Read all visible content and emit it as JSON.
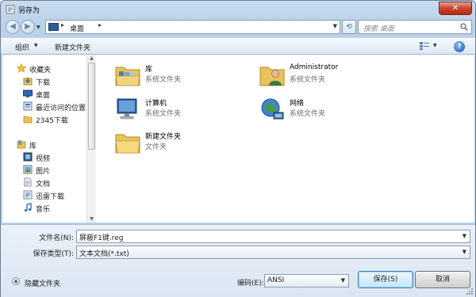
{
  "window": {
    "title": "另存为",
    "close_label": "✕"
  },
  "address": {
    "crumb": "桌面",
    "search_placeholder": "搜索 桌面"
  },
  "toolbar": {
    "organize_label": "组织",
    "new_folder_label": "新建文件夹"
  },
  "nav": {
    "favorites": [
      {
        "label": "收藏夹",
        "icon": "star-icon"
      },
      {
        "label": "下载",
        "icon": "download-folder-icon"
      },
      {
        "label": "桌面",
        "icon": "desktop-icon"
      },
      {
        "label": "最近访问的位置",
        "icon": "recent-places-icon"
      },
      {
        "label": "2345下载",
        "icon": "folder-icon"
      }
    ],
    "libraries": [
      {
        "label": "库",
        "icon": "library-icon"
      },
      {
        "label": "视频",
        "icon": "video-icon"
      },
      {
        "label": "图片",
        "icon": "picture-icon"
      },
      {
        "label": "文档",
        "icon": "document-icon"
      },
      {
        "label": "迅雷下载",
        "icon": "thunder-download-icon"
      },
      {
        "label": "音乐",
        "icon": "music-icon"
      }
    ]
  },
  "content": {
    "items": [
      {
        "name": "库",
        "type": "系统文件夹",
        "icon": "library-folder-icon"
      },
      {
        "name": "Administrator",
        "type": "系统文件夹",
        "icon": "user-folder-icon"
      },
      {
        "name": "计算机",
        "type": "系统文件夹",
        "icon": "computer-icon"
      },
      {
        "name": "网络",
        "type": "系统文件夹",
        "icon": "network-icon"
      },
      {
        "name": "新建文件夹",
        "type": "文件夹",
        "icon": "folder-icon"
      }
    ]
  },
  "form": {
    "filename_label": "文件名(N):",
    "filename_value": "屏蔽F1键.reg",
    "savetype_label": "保存类型(T):",
    "savetype_value": "文本文档(*.txt)",
    "hide_folders_label": "隐藏文件夹",
    "encoding_label": "编码(E):",
    "encoding_value": "ANSI",
    "save_label": "保存(S)",
    "cancel_label": "取消"
  },
  "colors": {
    "frame": "#b9d1ea",
    "folder": "#e8c35a",
    "accent": "#3c7fb1"
  }
}
